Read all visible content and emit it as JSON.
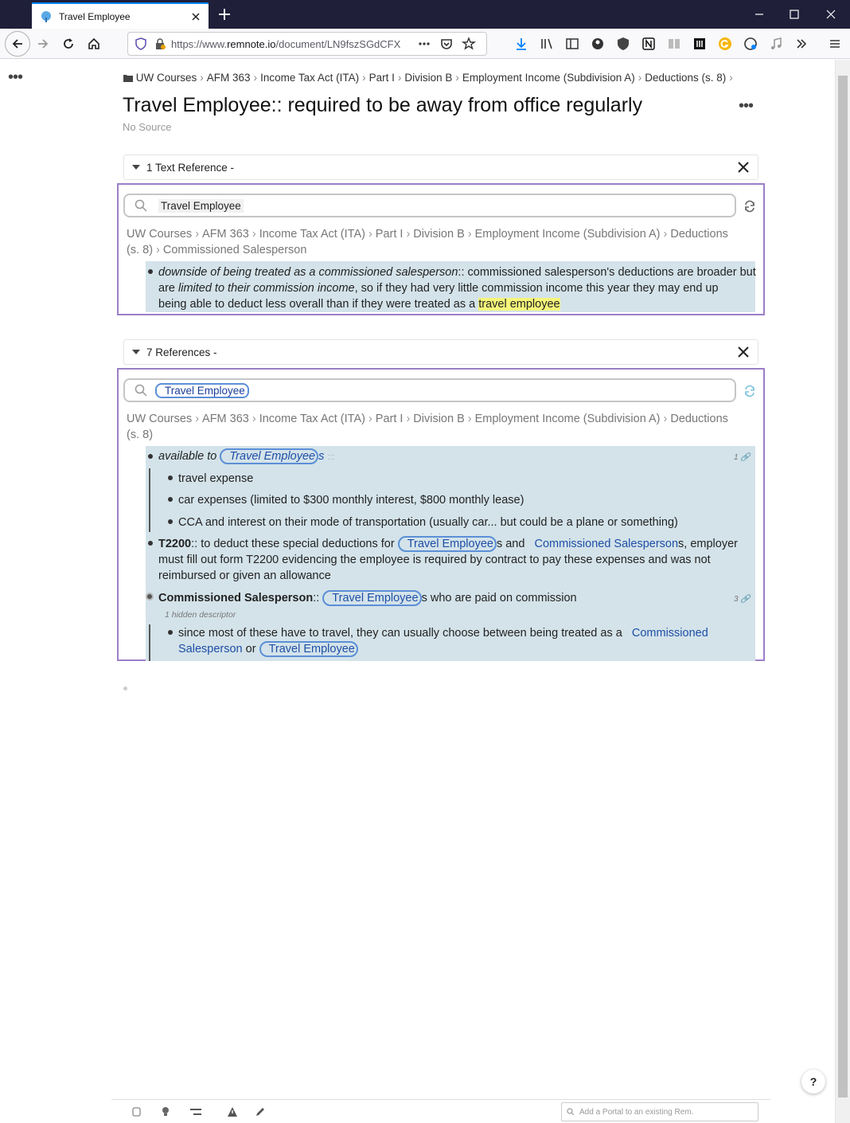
{
  "browser": {
    "tab_title": "Travel Employee",
    "url_prefix": "https://www.",
    "url_domain": "remnote.io",
    "url_path": "/document/LN9fszSGdCFX"
  },
  "page": {
    "breadcrumb": [
      "UW Courses",
      "AFM 363",
      "Income Tax Act (ITA)",
      "Part I",
      "Division B",
      "Employment Income (Subdivision A)",
      "Deductions (s. 8)"
    ],
    "title": "Travel Employee:: required to be away from office regularly",
    "source": "No Source"
  },
  "text_refs": {
    "header": "1 Text Reference -",
    "search_value": "Travel Employee",
    "path_line1": [
      "UW Courses",
      "AFM 363",
      "Income Tax Act (ITA)",
      "Part I",
      "Division B",
      "Employment Income (Subdivision A)",
      "Deductions"
    ],
    "path_line2_a": "(s. 8)",
    "path_line2_b": "Commissioned Salesperson",
    "item": {
      "italic_a": "downside of being treated as a commissioned salesperson",
      "sep": "::",
      "text_a": " commissioned salesperson's deductions are broader but",
      "text_b": "are ",
      "italic_b": "limited to their commission income",
      "text_c": ", so if they had very little commission income this year they may end up",
      "text_d": "being able to deduct less overall than if they were treated as a ",
      "highlight": "travel employee"
    }
  },
  "refs": {
    "header": "7 References -",
    "search_value": "Travel Employee",
    "path_line1": [
      "UW Courses",
      "AFM 363",
      "Income Tax Act (ITA)",
      "Part I",
      "Division B",
      "Employment Income (Subdivision A)",
      "Deductions"
    ],
    "path_line2": "(s. 8)",
    "item1": {
      "prefix": "available to ",
      "link": "Travel Employee",
      "suffix": "s",
      "ellipsis": ":::",
      "count": "1"
    },
    "children": [
      "travel expense",
      "car expenses (limited to $300 monthly interest, $800 monthly lease)",
      "CCA and interest on their mode of transportation (usually car... but could be a plane or something)"
    ],
    "item2": {
      "bold": "T2200",
      "a": ":: to deduct these special deductions for ",
      "link1": "Travel Employee",
      "b": "s and ",
      "link2": "Commissioned Salesperson",
      "c": "s, employer",
      "line2": "must fill out form T2200 evidencing the employee is required by contract to pay these expenses and was not",
      "line3": "reimbursed or given an allowance"
    },
    "item3": {
      "bold": "Commissioned Salesperson",
      "sep": ":: ",
      "link": "Travel Employee",
      "rest": "s who are paid on commission",
      "count": "3",
      "desc": "1 hidden descriptor"
    },
    "item4": {
      "a": "since most of these have to travel, they can usually choose between being treated as a ",
      "link1a": "Commissioned",
      "link1b": "Salesperson",
      "or": " or ",
      "link2": "Travel Employee"
    }
  },
  "footer": {
    "portal_placeholder": "Add a Portal to an existing Rem.",
    "help": "?"
  }
}
